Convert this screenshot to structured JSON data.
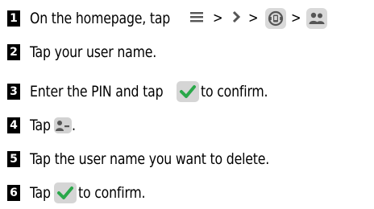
{
  "steps": [
    {
      "number": "1",
      "text_before": "On the homepage, tap",
      "separators": [
        ">",
        ">",
        ">",
        ">"
      ],
      "icons": [
        "menu-icon",
        "chevron-right-icon",
        "device-settings-icon",
        "users-icon"
      ]
    },
    {
      "number": "2",
      "text": "Tap your user name."
    },
    {
      "number": "3",
      "text_before": "Enter the PIN and tap",
      "text_after": "to confirm.",
      "icons": [
        "checkmark-icon"
      ]
    },
    {
      "number": "4",
      "text_before": "Tap",
      "text_after": ".",
      "icons": [
        "remove-user-icon"
      ]
    },
    {
      "number": "5",
      "text": "Tap the user name you want to delete."
    },
    {
      "number": "6",
      "text_before": "Tap",
      "text_after": "to confirm.",
      "icons": [
        "checkmark-icon"
      ]
    }
  ],
  "colors": {
    "check_green": "#2aa84a",
    "icon_tile": "#d9d9d9",
    "icon_glyph": "#555555"
  }
}
